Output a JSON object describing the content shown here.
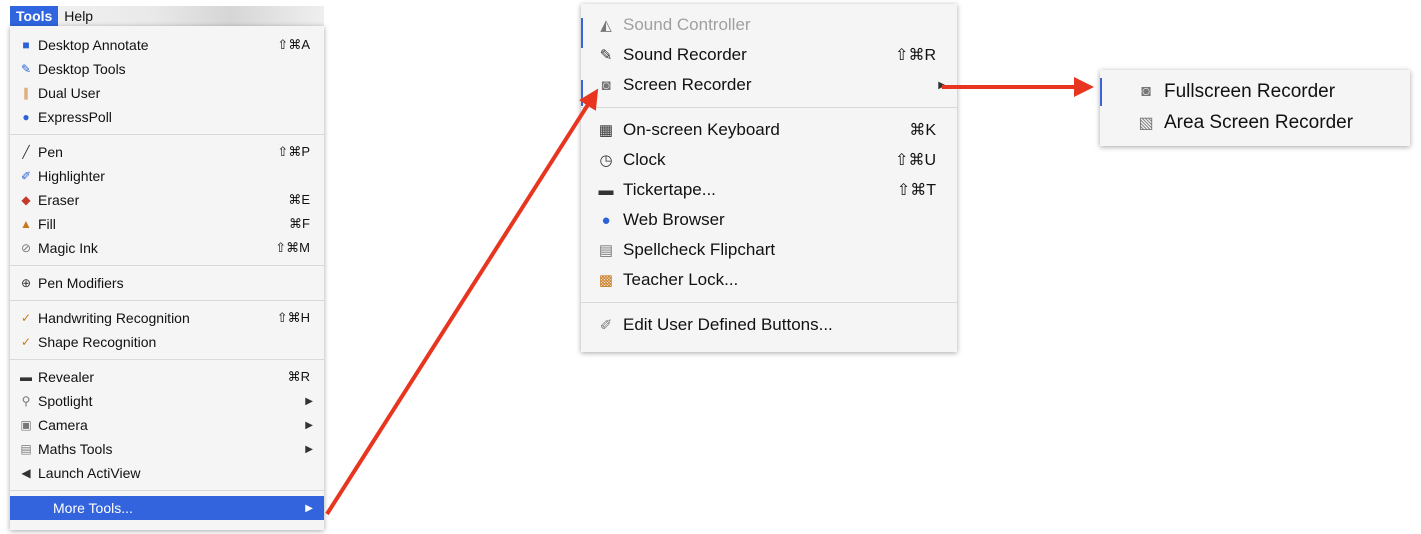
{
  "menubar": {
    "tools": "Tools",
    "help": "Help"
  },
  "tools_menu": {
    "desktop_annotate": {
      "label": "Desktop Annotate",
      "shortcut": "⇧⌘A"
    },
    "desktop_tools": {
      "label": "Desktop Tools"
    },
    "dual_user": {
      "label": "Dual User"
    },
    "expresspoll": {
      "label": "ExpressPoll"
    },
    "pen": {
      "label": "Pen",
      "shortcut": "⇧⌘P"
    },
    "highlighter": {
      "label": "Highlighter"
    },
    "eraser": {
      "label": "Eraser",
      "shortcut": "⌘E"
    },
    "fill": {
      "label": "Fill",
      "shortcut": "⌘F"
    },
    "magic_ink": {
      "label": "Magic Ink",
      "shortcut": "⇧⌘M"
    },
    "pen_modifiers": {
      "label": "Pen Modifiers"
    },
    "handwriting": {
      "label": "Handwriting Recognition",
      "shortcut": "⇧⌘H"
    },
    "shape": {
      "label": "Shape Recognition"
    },
    "revealer": {
      "label": "Revealer",
      "shortcut": "⌘R"
    },
    "spotlight": {
      "label": "Spotlight"
    },
    "camera": {
      "label": "Camera"
    },
    "maths_tools": {
      "label": "Maths Tools"
    },
    "launch_actiview": {
      "label": "Launch ActiView"
    },
    "more_tools": {
      "label": "More Tools..."
    }
  },
  "more_tools_menu": {
    "sound_controller": {
      "label": "Sound Controller"
    },
    "sound_recorder": {
      "label": "Sound Recorder",
      "shortcut": "⇧⌘R"
    },
    "screen_recorder": {
      "label": "Screen Recorder"
    },
    "onscreen_keyboard": {
      "label": "On-screen Keyboard",
      "shortcut": "⌘K"
    },
    "clock": {
      "label": "Clock",
      "shortcut": "⇧⌘U"
    },
    "tickertape": {
      "label": "Tickertape...",
      "shortcut": "⇧⌘T"
    },
    "web_browser": {
      "label": "Web Browser"
    },
    "spellcheck": {
      "label": "Spellcheck Flipchart"
    },
    "teacher_lock": {
      "label": "Teacher Lock..."
    },
    "edit_buttons": {
      "label": "Edit User Defined Buttons..."
    }
  },
  "screen_recorder_menu": {
    "fullscreen": {
      "label": "Fullscreen Recorder"
    },
    "area": {
      "label": "Area Screen Recorder"
    }
  },
  "colors": {
    "highlight": "#3363dd",
    "arrow": "#e8351f",
    "menu_bg": "#f5f5f5"
  }
}
